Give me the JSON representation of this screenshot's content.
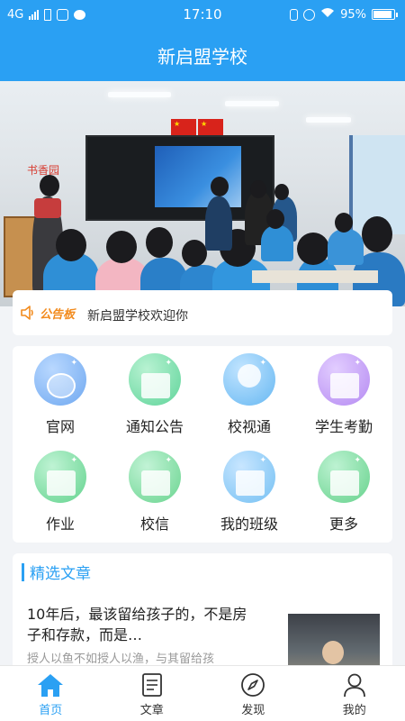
{
  "status_bar": {
    "network": "4G",
    "time": "17:10",
    "battery": "95%"
  },
  "header": {
    "title": "新启盟学校"
  },
  "banner": {
    "sign_text": "书香园"
  },
  "notice": {
    "label": "公告板",
    "text": "新启盟学校欢迎你"
  },
  "menu": {
    "items": [
      {
        "label": "官网",
        "icon": "globe-icon",
        "color": "#6fa8f0"
      },
      {
        "label": "通知公告",
        "icon": "notice-icon",
        "color": "#5fd49a"
      },
      {
        "label": "校视通",
        "icon": "camera-icon",
        "color": "#67b8f2"
      },
      {
        "label": "学生考勤",
        "icon": "attendance-icon",
        "color": "#b58af2"
      },
      {
        "label": "作业",
        "icon": "homework-icon",
        "color": "#63d38e"
      },
      {
        "label": "校信",
        "icon": "message-icon",
        "color": "#69d48f"
      },
      {
        "label": "我的班级",
        "icon": "class-icon",
        "color": "#74c0f3"
      },
      {
        "label": "更多",
        "icon": "more-icon",
        "color": "#66d28c"
      }
    ]
  },
  "articles": {
    "section_title": "精选文章",
    "items": [
      {
        "title": "10年后，最该留给孩子的，不是房子和存款，而是…",
        "summary": "授人以鱼不如授人以渔，与其留给孩"
      }
    ]
  },
  "tabs": [
    {
      "label": "首页",
      "icon": "home-icon",
      "active": true
    },
    {
      "label": "文章",
      "icon": "article-icon",
      "active": false
    },
    {
      "label": "发现",
      "icon": "compass-icon",
      "active": false
    },
    {
      "label": "我的",
      "icon": "profile-icon",
      "active": false
    }
  ],
  "colors": {
    "accent": "#2aa0f3",
    "notice_label": "#f28b1e"
  }
}
